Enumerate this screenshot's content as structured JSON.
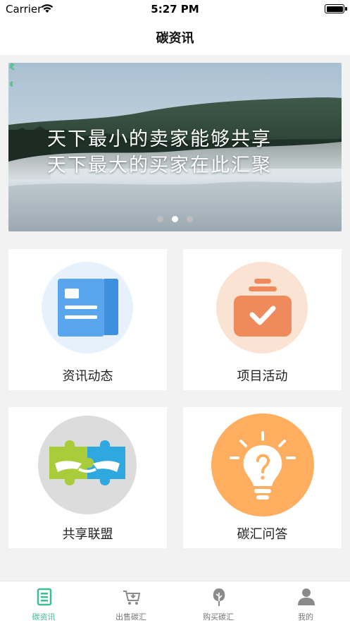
{
  "status_bar": {
    "carrier": "Carrier",
    "time": "5:27 PM"
  },
  "nav": {
    "title": "碳资讯"
  },
  "banner": {
    "line1": "天下最小的卖家能够共享",
    "line2": "天下最大的买家在此汇聚",
    "slide_count": 3,
    "active_slide": 2
  },
  "cards": [
    {
      "label": "资讯动态",
      "icon": "newspaper-icon"
    },
    {
      "label": "项目活动",
      "icon": "checkbox-bag-icon"
    },
    {
      "label": "共享联盟",
      "icon": "puzzle-handshake-icon"
    },
    {
      "label": "碳汇问答",
      "icon": "lightbulb-question-icon"
    }
  ],
  "tabs": [
    {
      "label": "碳资讯",
      "icon": "news-list-icon",
      "active": true
    },
    {
      "label": "出售碳汇",
      "icon": "cart-download-icon",
      "active": false
    },
    {
      "label": "购买碳汇",
      "icon": "tree-icon",
      "active": false
    },
    {
      "label": "我的",
      "icon": "user-icon",
      "active": false
    }
  ],
  "colors": {
    "accent": "#3cbf92",
    "news_circle": "#e6f1fc",
    "project_circle": "#fbe3d3",
    "puzzle_circle": "#dcdcdc",
    "qa_circle": "#ffad5e"
  }
}
